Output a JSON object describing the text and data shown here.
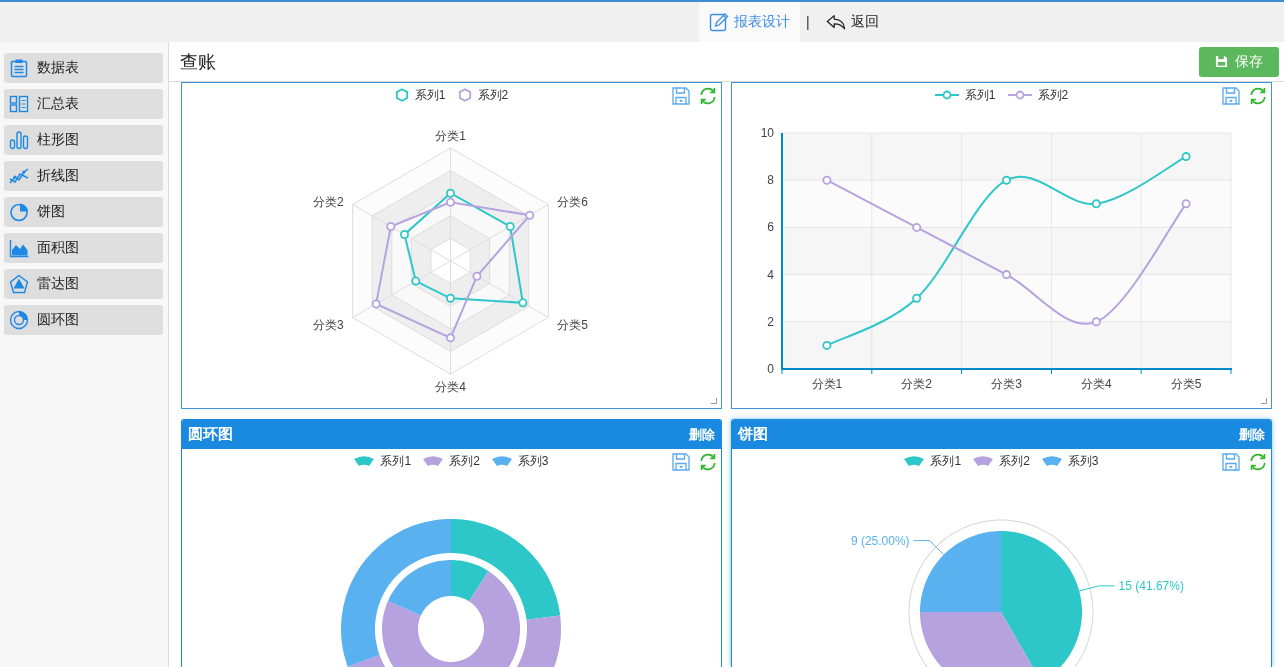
{
  "topbar": {
    "tabs": [
      {
        "kind": "design",
        "label": "报表设计",
        "selected": true
      },
      {
        "kind": "back",
        "label": "返回",
        "selected": false
      }
    ],
    "separator": "|"
  },
  "sidebar": {
    "items": [
      {
        "kind": "table",
        "label": "数据表"
      },
      {
        "kind": "summary",
        "label": "汇总表"
      },
      {
        "kind": "bar",
        "label": "柱形图"
      },
      {
        "kind": "line",
        "label": "折线图"
      },
      {
        "kind": "pie",
        "label": "饼图"
      },
      {
        "kind": "area",
        "label": "面积图"
      },
      {
        "kind": "radar",
        "label": "雷达图"
      },
      {
        "kind": "donut",
        "label": "圆环图"
      }
    ]
  },
  "header": {
    "title": "查账",
    "save_button": "保存"
  },
  "panels": [
    {
      "kind": "radar",
      "focused": false,
      "legend": [
        {
          "label": "系列1",
          "color": "#2ec7c9"
        },
        {
          "label": "系列2",
          "color": "#b6a2de"
        }
      ],
      "axes": [
        "分类1",
        "分类2",
        "分类3",
        "分类4",
        "分类5",
        "分类6"
      ]
    },
    {
      "kind": "line",
      "focused": false,
      "chart_data": {
        "type": "line",
        "categories": [
          "分类1",
          "分类2",
          "分类3",
          "分类4",
          "分类5"
        ],
        "series": [
          {
            "name": "系列1",
            "color": "#2ec7c9",
            "marker": true,
            "values": [
              1,
              3,
              8,
              7,
              9
            ]
          },
          {
            "name": "系列2",
            "color": "#b6a2de",
            "marker": true,
            "values": [
              8,
              6,
              4,
              2,
              7
            ]
          }
        ],
        "ylim": [
          0,
          10
        ],
        "yticks": [
          0,
          2,
          4,
          6,
          8,
          10
        ],
        "grid": true
      }
    },
    {
      "kind": "donut",
      "focused": false,
      "title": "圆环图",
      "delete_button": "删除",
      "legend": [
        {
          "label": "系列1",
          "color": "#2ec7c9"
        },
        {
          "label": "系列2",
          "color": "#b6a2de"
        },
        {
          "label": "系列3",
          "color": "#5ab1ef"
        }
      ]
    },
    {
      "kind": "pie",
      "focused": true,
      "title": "饼图",
      "delete_button": "删除",
      "chart_data": {
        "type": "pie",
        "categories": [
          "系列1",
          "系列2",
          "系列3"
        ],
        "values": [
          15,
          12,
          9
        ],
        "colors": [
          "#2ec7c9",
          "#b6a2de",
          "#5ab1ef"
        ],
        "value_labels": [
          "15 (41.67%)",
          null,
          "9 (25.00%)"
        ]
      }
    }
  ]
}
